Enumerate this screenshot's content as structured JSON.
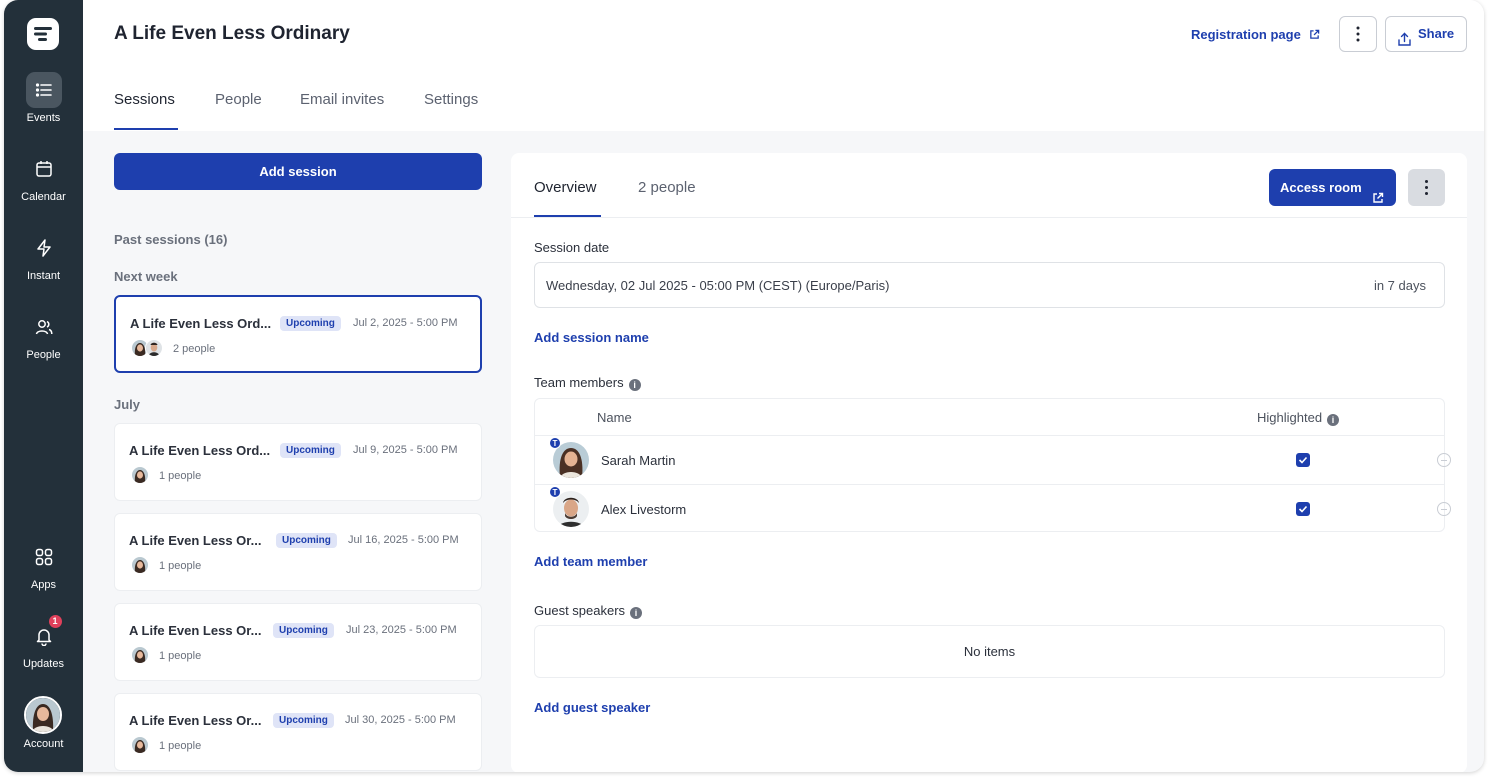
{
  "nav": {
    "items": [
      {
        "label": "Events",
        "icon": "list-icon"
      },
      {
        "label": "Calendar",
        "icon": "calendar-icon"
      },
      {
        "label": "Instant",
        "icon": "bolt-icon"
      },
      {
        "label": "People",
        "icon": "people-icon"
      },
      {
        "label": "Apps",
        "icon": "apps-grid-icon"
      },
      {
        "label": "Updates",
        "icon": "bell-icon",
        "badge": "1"
      },
      {
        "label": "Account",
        "icon": "avatar"
      }
    ]
  },
  "header": {
    "title": "A Life Even Less Ordinary",
    "registration_label": "Registration page",
    "share_label": "Share",
    "tabs": [
      "Sessions",
      "People",
      "Email invites",
      "Settings"
    ]
  },
  "sessions": {
    "add_label": "Add session",
    "past_label": "Past sessions (16)",
    "group_next_week": "Next week",
    "group_july": "July",
    "items": [
      {
        "title": "A Life Even Less Ord...",
        "status": "Upcoming",
        "date": "Jul 2, 2025 - 5:00 PM",
        "people": "2 people"
      },
      {
        "title": "A Life Even Less Ord...",
        "status": "Upcoming",
        "date": "Jul 9, 2025 - 5:00 PM",
        "people": "1 people"
      },
      {
        "title": "A Life Even Less Or...",
        "status": "Upcoming",
        "date": "Jul 16, 2025 - 5:00 PM",
        "people": "1 people"
      },
      {
        "title": "A Life Even Less Or...",
        "status": "Upcoming",
        "date": "Jul 23, 2025 - 5:00 PM",
        "people": "1 people"
      },
      {
        "title": "A Life Even Less Or...",
        "status": "Upcoming",
        "date": "Jul 30, 2025 - 5:00 PM",
        "people": "1 people"
      }
    ]
  },
  "panel": {
    "tab_overview": "Overview",
    "tab_people": "2 people",
    "access_label": "Access room",
    "session_date_label": "Session date",
    "session_date_value": "Wednesday, 02 Jul 2025 - 05:00 PM (CEST) (Europe/Paris)",
    "session_date_relative": "in 7 days",
    "add_session_name": "Add session name",
    "team_label": "Team members",
    "col_name": "Name",
    "col_highlighted": "Highlighted",
    "members": [
      {
        "name": "Sarah Martin",
        "badge": "T",
        "highlighted": true
      },
      {
        "name": "Alex Livestorm",
        "badge": "T",
        "highlighted": true
      }
    ],
    "add_team_member": "Add team member",
    "guest_label": "Guest speakers",
    "guest_empty": "No items",
    "add_guest_speaker": "Add guest speaker"
  },
  "colors": {
    "accent": "#1e3fae",
    "rail": "#23303a",
    "badge_bg": "#dfe4f7",
    "alert": "#e0405b"
  }
}
